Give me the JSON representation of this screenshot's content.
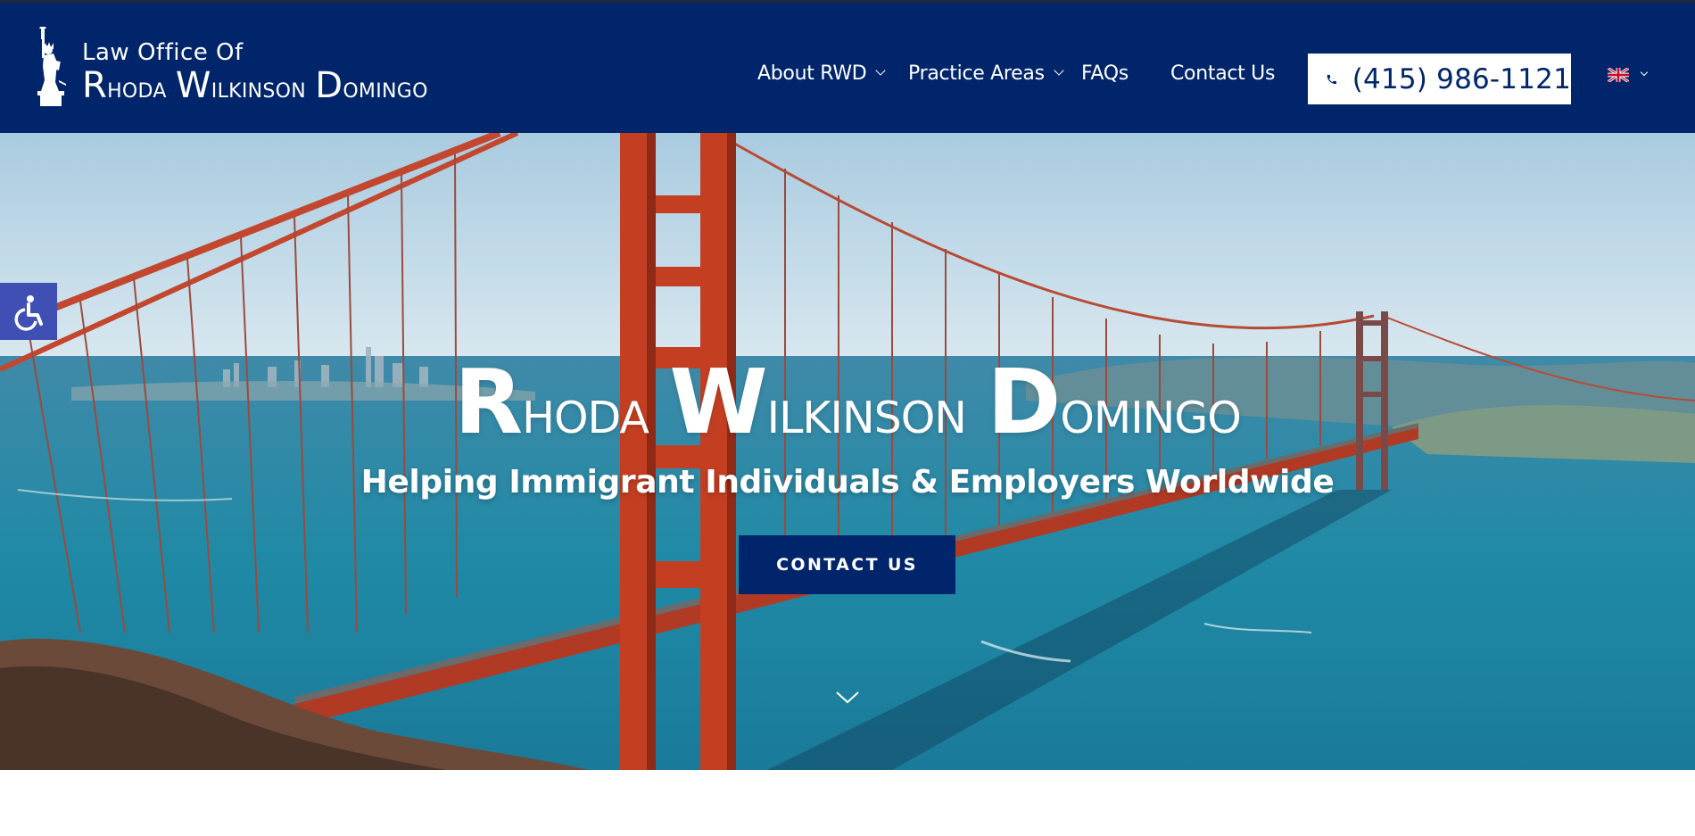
{
  "header": {
    "logo": {
      "line1": "Law Office Of",
      "name_parts": [
        {
          "cap": "R",
          "rest": "hoda"
        },
        {
          "cap": "W",
          "rest": "ilkinson"
        },
        {
          "cap": "D",
          "rest": "omingo"
        }
      ]
    },
    "nav": [
      {
        "label": "About RWD",
        "has_dropdown": true
      },
      {
        "label": "Practice Areas",
        "has_dropdown": true
      },
      {
        "label": "FAQs",
        "has_dropdown": false
      },
      {
        "label": "Contact Us",
        "has_dropdown": false
      }
    ],
    "phone": {
      "icon": "phone-icon",
      "number": "(415) 986-1121"
    },
    "language": {
      "icon": "uk-flag-icon",
      "has_dropdown": true
    }
  },
  "accessibility": {
    "icon": "accessibility-icon"
  },
  "hero": {
    "title_parts": [
      {
        "cap": "R",
        "rest": "hoda"
      },
      {
        "cap": "W",
        "rest": "ilkinson"
      },
      {
        "cap": "D",
        "rest": "omingo"
      }
    ],
    "subtitle": "Helping Immigrant Individuals & Employers Worldwide",
    "cta_label": "CONTACT US",
    "scroll_icon": "chevron-down-icon",
    "background": "golden-gate-bridge-photo"
  },
  "colors": {
    "brand_navy": "#00256a",
    "topbar": "#1c2743",
    "accessibility_blue": "#3f4fb3",
    "white": "#ffffff"
  }
}
